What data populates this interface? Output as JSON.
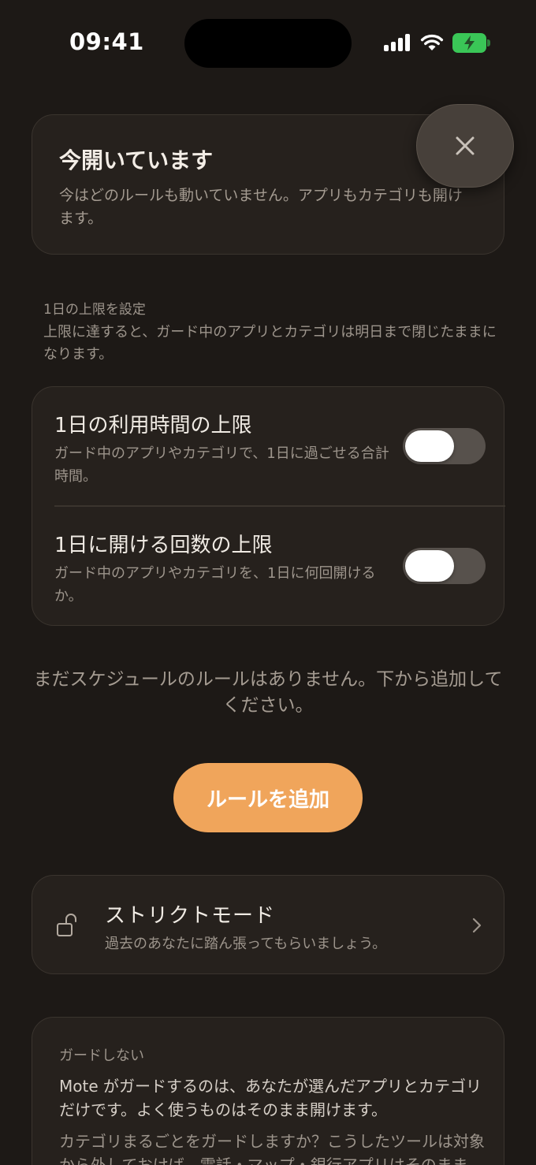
{
  "status": {
    "time": "09:41"
  },
  "open_card": {
    "title": "今開いています",
    "description": "今はどのルールも動いていません。アプリもカテゴリも開けます。"
  },
  "limits_section": {
    "label": "1日の上限を設定",
    "description": "上限に達すると、ガード中のアプリとカテゴリは明日まで閉じたままになります。"
  },
  "limits": [
    {
      "title": "1日の利用時間の上限",
      "description": "ガード中のアプリやカテゴリで、1日に過ごせる合計時間。",
      "enabled": false
    },
    {
      "title": "1日に開ける回数の上限",
      "description": "ガード中のアプリやカテゴリを、1日に何回開けるか。",
      "enabled": false
    }
  ],
  "empty_message": "まだスケジュールのルールはありません。下から追加してください。",
  "add_rule_label": "ルールを追加",
  "strict_mode": {
    "title": "ストリクトモード",
    "description": "過去のあなたに踏ん張ってもらいましょう。",
    "icon": "unlock-icon"
  },
  "no_guard": {
    "label": "ガードしない",
    "text": "Mote がガードするのは、あなたが選んだアプリとカテゴリだけです。よく使うものはそのまま開けます。",
    "text2": "カテゴリまるごとをガードしますか？こうしたツールは対象から外しておけば、電話・マップ・銀行アプリはそのまま"
  },
  "colors": {
    "background": "#1d1916",
    "card": "#26211d",
    "accent": "#f0a55b",
    "battery": "#3ac657"
  }
}
